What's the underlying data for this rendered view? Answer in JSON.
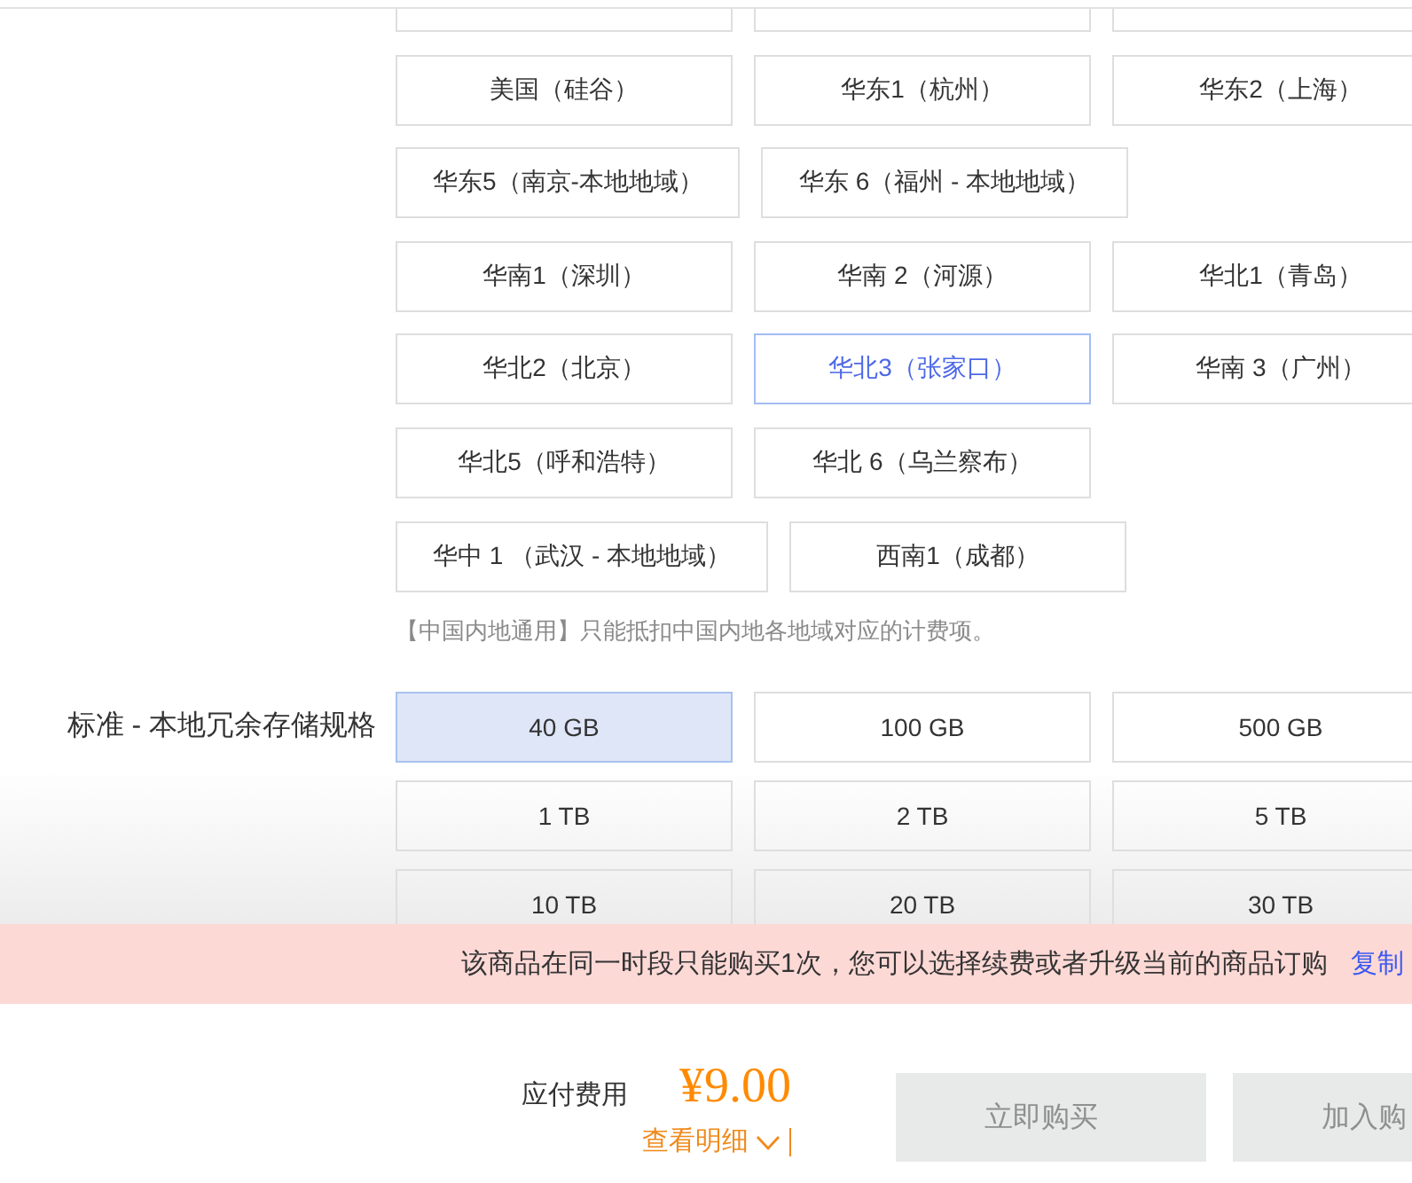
{
  "regions": {
    "cut_off_buttons": [
      {
        "selected": false
      },
      {
        "selected": false
      },
      {
        "selected": false
      }
    ],
    "options": [
      {
        "label": "美国（硅谷）",
        "selected": false
      },
      {
        "label": "华东1（杭州）",
        "selected": false
      },
      {
        "label": "华东2（上海）",
        "selected": false
      },
      {
        "label": "华东5（南京-本地地域）",
        "selected": false
      },
      {
        "label": "华东 6（福州 - 本地地域）",
        "selected": false
      },
      {
        "label": "华南1（深圳）",
        "selected": false
      },
      {
        "label": "华南 2（河源）",
        "selected": false
      },
      {
        "label": "华北1（青岛）",
        "selected": false
      },
      {
        "label": "华北2（北京）",
        "selected": false
      },
      {
        "label": "华北3（张家口）",
        "selected": true
      },
      {
        "label": "华南 3（广州）",
        "selected": false
      },
      {
        "label": "华北5（呼和浩特）",
        "selected": false
      },
      {
        "label": "华北 6（乌兰察布）",
        "selected": false
      },
      {
        "label": "华中 1 （武汉 - 本地地域）",
        "selected": false
      },
      {
        "label": "西南1（成都）",
        "selected": false
      }
    ],
    "note": "【中国内地通用】只能抵扣中国内地各地域对应的计费项。"
  },
  "storage": {
    "label": "标准 - 本地冗余存储规格",
    "options": [
      {
        "label": "40 GB",
        "selected": true
      },
      {
        "label": "100 GB",
        "selected": false
      },
      {
        "label": "500 GB",
        "selected": false
      },
      {
        "label": "1 TB",
        "selected": false
      },
      {
        "label": "2 TB",
        "selected": false
      },
      {
        "label": "5 TB",
        "selected": false
      },
      {
        "label": "10 TB",
        "selected": false
      },
      {
        "label": "20 TB",
        "selected": false
      },
      {
        "label": "30 TB",
        "selected": false
      }
    ]
  },
  "notice": {
    "text": "该商品在同一时段只能购买1次，您可以选择续费或者升级当前的商品订购",
    "link": "复制"
  },
  "checkout": {
    "fee_label": "应付费用",
    "price": "¥9.00",
    "details_link": "查看明细",
    "buttons": [
      {
        "label": "立即购买",
        "disabled": true
      },
      {
        "label": "加入购",
        "disabled": true
      }
    ]
  }
}
